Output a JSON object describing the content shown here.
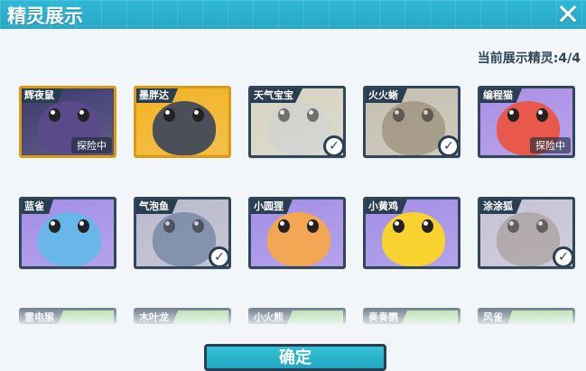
{
  "header": {
    "title": "精灵展示"
  },
  "close_icon": "close-icon",
  "display_count": "当前展示精灵:4/4",
  "sprites": [
    {
      "name": "辉夜鼠",
      "status": "探险中",
      "displayed": false,
      "bg": "#3b3a6c",
      "face": "#5a4a8a",
      "frame": "gold"
    },
    {
      "name": "墨胖达",
      "status": "",
      "displayed": false,
      "bg": "#f3b323",
      "face": "#4a4f58",
      "frame": "gold"
    },
    {
      "name": "天气宝宝",
      "status": "",
      "displayed": true,
      "bg": "#c9b875",
      "face": "#c9d4e0",
      "frame": "dim"
    },
    {
      "name": "火火蜥",
      "status": "",
      "displayed": true,
      "bg": "#a99357",
      "face": "#9b7a4a",
      "frame": "dim"
    },
    {
      "name": "编程猫",
      "status": "探险中",
      "displayed": false,
      "bg": "#a98fe6",
      "face": "#e8594b",
      "frame": "purple"
    },
    {
      "name": "蓝雀",
      "status": "",
      "displayed": false,
      "bg": "#a38ee6",
      "face": "#69b6ea",
      "frame": "purple"
    },
    {
      "name": "气泡鱼",
      "status": "",
      "displayed": true,
      "bg": "#8f86c6",
      "face": "#3a6fb8",
      "frame": "dim"
    },
    {
      "name": "小圆狸",
      "status": "",
      "displayed": false,
      "bg": "#a38ee6",
      "face": "#f3a653",
      "frame": "purple"
    },
    {
      "name": "小黄鸡",
      "status": "",
      "displayed": false,
      "bg": "#a38ee6",
      "face": "#f8d22f",
      "frame": "purple"
    },
    {
      "name": "涂涂狐",
      "status": "",
      "displayed": true,
      "bg": "#a597d0",
      "face": "#a99181",
      "frame": "dim"
    },
    {
      "name": "雷电猴",
      "status": "",
      "displayed": false,
      "bg": "#8fd37d",
      "face": "#8fd37d",
      "frame": "green"
    },
    {
      "name": "木叶龙",
      "status": "",
      "displayed": false,
      "bg": "#8fd37d",
      "face": "#8fd37d",
      "frame": "green"
    },
    {
      "name": "小火熊",
      "status": "",
      "displayed": false,
      "bg": "#8fd37d",
      "face": "#8fd37d",
      "frame": "green"
    },
    {
      "name": "奏奏鹦",
      "status": "",
      "displayed": false,
      "bg": "#8fd37d",
      "face": "#8fd37d",
      "frame": "green"
    },
    {
      "name": "风雀",
      "status": "",
      "displayed": false,
      "bg": "#8fd37d",
      "face": "#8fd37d",
      "frame": "green"
    }
  ],
  "bottom_button": {
    "label": "确定"
  },
  "colors": {
    "header_bg": "#2bb2d0",
    "card_border": "#31465a",
    "gold_border": "#d79a1a",
    "check_icon": "check-circle-icon"
  }
}
